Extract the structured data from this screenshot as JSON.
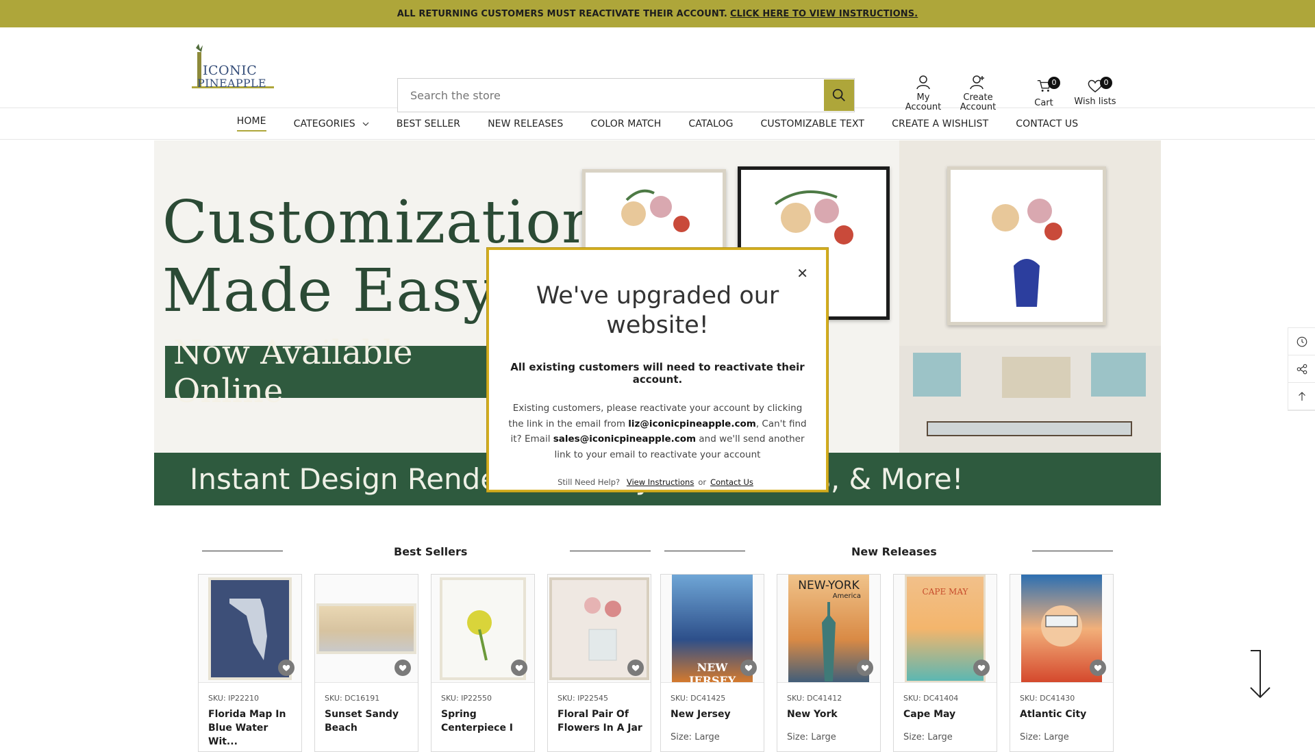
{
  "announcement": {
    "text": "ALL RETURNING CUSTOMERS MUST REACTIVATE THEIR ACCOUNT.",
    "link": "CLICK HERE TO VIEW INSTRUCTIONS."
  },
  "logo": {
    "line1": "ICONIC",
    "line2": "PINEAPPLE"
  },
  "search": {
    "placeholder": "Search the store"
  },
  "header_icons": {
    "account": {
      "line1": "My",
      "line2": "Account"
    },
    "create": {
      "line1": "Create",
      "line2": "Account"
    },
    "cart": {
      "label": "Cart",
      "count": "0"
    },
    "wishlist": {
      "label": "Wish lists",
      "count": "0"
    }
  },
  "nav": {
    "items": [
      "HOME",
      "CATEGORIES",
      "BEST SELLER",
      "NEW RELEASES",
      "COLOR MATCH",
      "CATALOG",
      "CUSTOMIZABLE TEXT",
      "CREATE A WISHLIST",
      "CONTACT US"
    ]
  },
  "banner": {
    "headline1": "Customization",
    "headline2": "Made Easy!",
    "pill": "Now Available Online",
    "strip": "Instant Design Renders, Im                   very Preferences, & More!"
  },
  "sections": {
    "best": "Best Sellers",
    "new": "New Releases"
  },
  "products": [
    {
      "sku": "SKU: IP22210",
      "name": "Florida Map In Blue Water Wit...",
      "size": ""
    },
    {
      "sku": "SKU: DC16191",
      "name": "Sunset Sandy Beach",
      "size": ""
    },
    {
      "sku": "SKU: IP22550",
      "name": "Spring Centerpiece I",
      "size": ""
    },
    {
      "sku": "SKU: IP22545",
      "name": "Floral Pair Of Flowers In A Jar",
      "size": ""
    },
    {
      "sku": "SKU: DC41425",
      "name": "New Jersey",
      "size": "Size: Large"
    },
    {
      "sku": "SKU: DC41412",
      "name": "New York",
      "size": "Size: Large"
    },
    {
      "sku": "SKU: DC41404",
      "name": "Cape May",
      "size": "Size: Large"
    },
    {
      "sku": "SKU: DC41430",
      "name": "Atlantic City",
      "size": "Size: Large"
    }
  ],
  "poster_text": {
    "nj": "NEW JERSEY",
    "ny": "NEW-YORK",
    "ny_sub": "America",
    "cm": "CAPE MAY"
  },
  "modal": {
    "title": "We've upgraded our website!",
    "lead": "All existing customers will need to reactivate their account.",
    "body1": "Existing customers, please reactivate your account by clicking the link in the email from ",
    "email1": "liz@iconicpineapple.com",
    "body2": ", Can't find it? Email ",
    "email2": "sales@iconicpineapple.com",
    "body3": " and we'll send another link to your email to reactivate your account",
    "help": "Still Need Help?",
    "link1": "View Instructions",
    "or": "or",
    "link2": "Contact Us"
  },
  "colors": {
    "accent": "#aea63a",
    "banner_green": "#2f5a3e",
    "modal_border": "#d3ad1f"
  }
}
